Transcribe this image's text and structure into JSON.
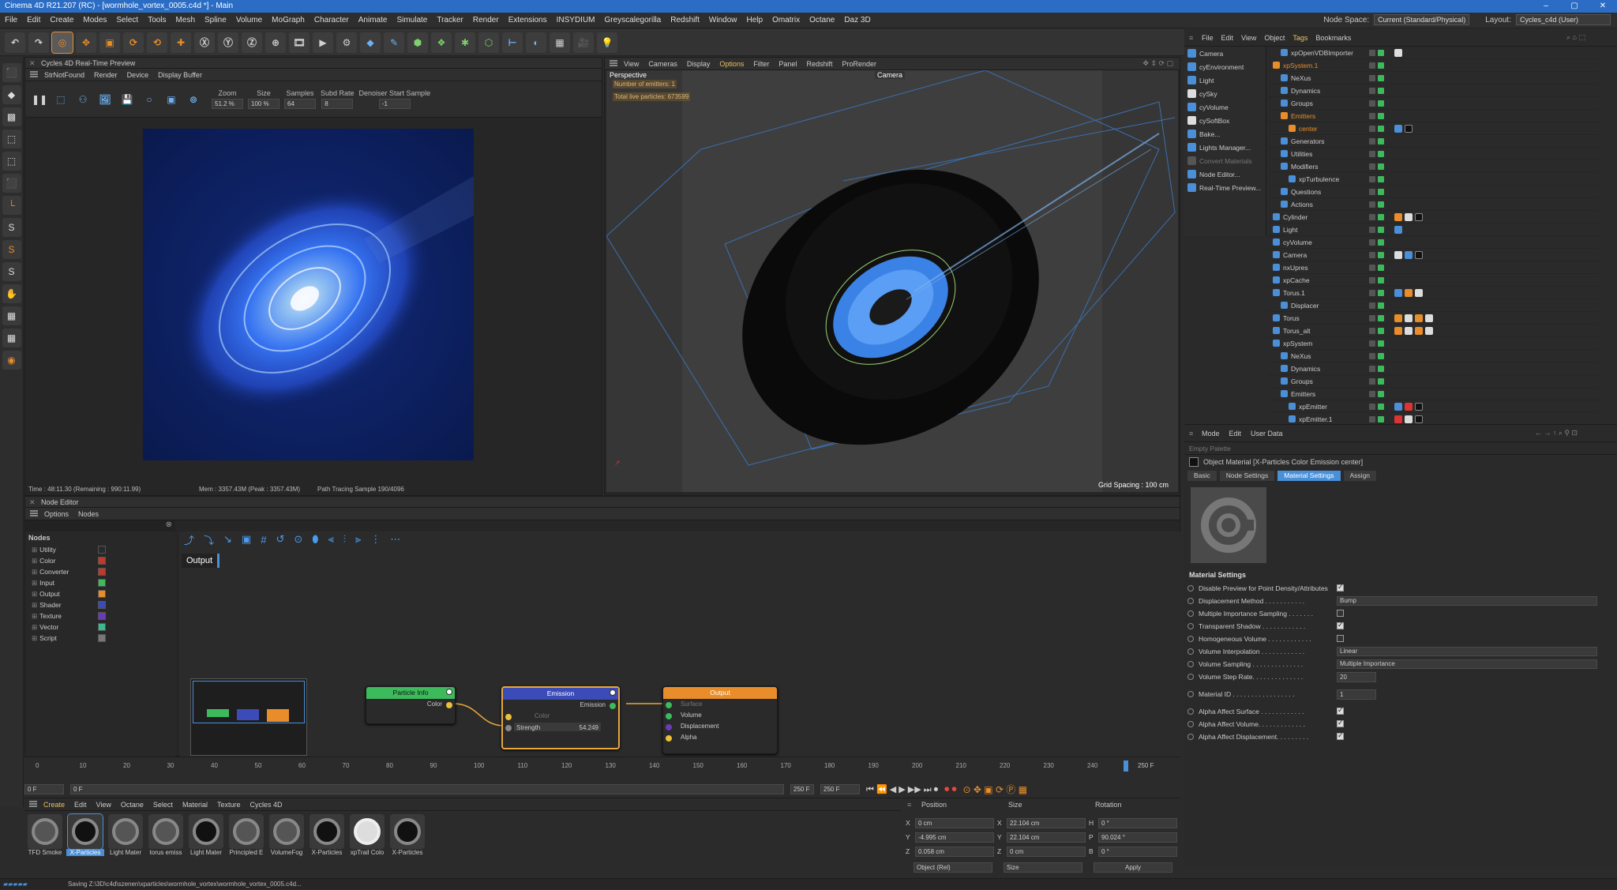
{
  "title": "Cinema 4D R21.207 (RC) - [wormhole_vortex_0005.c4d *] - Main",
  "menubar": [
    "File",
    "Edit",
    "Create",
    "Modes",
    "Select",
    "Tools",
    "Mesh",
    "Spline",
    "Volume",
    "MoGraph",
    "Character",
    "Animate",
    "Simulate",
    "Tracker",
    "Render",
    "Extensions",
    "INSYDIUM",
    "Greyscalegorilla",
    "Redshift",
    "Window",
    "Help",
    "Omatrix",
    "Octane",
    "Daz 3D"
  ],
  "node_space_label": "Node Space:",
  "node_space_value": "Current (Standard/Physical)",
  "layout_label": "Layout:",
  "layout_value": "Cycles_c4d (User)",
  "rtp": {
    "title": "Cycles 4D Real-Time Preview",
    "menu": [
      "StrNotFound",
      "Render",
      "Device",
      "Display Buffer"
    ],
    "zoom_label": "Zoom",
    "zoom": "51.2 %",
    "size_label": "Size",
    "size": "100 %",
    "samples_label": "Samples",
    "samples": "64",
    "subd_label": "Subd Rate",
    "subd": "8",
    "denoiser_label": "Denoiser Start Sample",
    "denoiser": "-1",
    "status_time": "Time : 48:11.30 (Remaining : 990:11.99)",
    "status_mem": "Mem : 3357.43M (Peak : 3357.43M)",
    "status_path": "Path Tracing Sample 190/4096"
  },
  "viewport": {
    "menu": [
      "View",
      "Cameras",
      "Display",
      "Options",
      "Filter",
      "Panel",
      "Redshift",
      "ProRender"
    ],
    "label": "Perspective",
    "camera": "Camera",
    "emitters": "Number of emitters: 1",
    "particles": "Total live particles: 673599",
    "grid": "Grid Spacing : 100 cm"
  },
  "objmgr": {
    "menu": [
      "File",
      "Edit",
      "View",
      "Object",
      "Tags",
      "Bookmarks"
    ],
    "quick": [
      "Camera",
      "cyEnvironment",
      "Light",
      "cySky",
      "cyVolume",
      "cySoftBox",
      "Bake...",
      "Lights Manager...",
      "Convert Materials",
      "Node Editor...",
      "Real-Time Preview..."
    ],
    "tree": [
      {
        "name": "xpOpenVDBImporter",
        "indent": 1,
        "orange": false
      },
      {
        "name": "xpSystem.1",
        "indent": 0,
        "orange": true
      },
      {
        "name": "NeXus",
        "indent": 1,
        "orange": false
      },
      {
        "name": "Dynamics",
        "indent": 1,
        "orange": false
      },
      {
        "name": "Groups",
        "indent": 1,
        "orange": false
      },
      {
        "name": "Emitters",
        "indent": 1,
        "orange": true
      },
      {
        "name": "center",
        "indent": 2,
        "orange": true
      },
      {
        "name": "Generators",
        "indent": 1,
        "orange": false
      },
      {
        "name": "Utilities",
        "indent": 1,
        "orange": false
      },
      {
        "name": "Modifiers",
        "indent": 1,
        "orange": false
      },
      {
        "name": "xpTurbulence",
        "indent": 2,
        "orange": false
      },
      {
        "name": "Questions",
        "indent": 1,
        "orange": false
      },
      {
        "name": "Actions",
        "indent": 1,
        "orange": false
      },
      {
        "name": "Cylinder",
        "indent": 0,
        "orange": false
      },
      {
        "name": "Light",
        "indent": 0,
        "orange": false
      },
      {
        "name": "cyVolume",
        "indent": 0,
        "orange": false
      },
      {
        "name": "Camera",
        "indent": 0,
        "orange": false
      },
      {
        "name": "nxUpres",
        "indent": 0,
        "orange": false
      },
      {
        "name": "xpCache",
        "indent": 0,
        "orange": false
      },
      {
        "name": "Torus.1",
        "indent": 0,
        "orange": false
      },
      {
        "name": "Displacer",
        "indent": 1,
        "orange": false
      },
      {
        "name": "Torus",
        "indent": 0,
        "orange": false
      },
      {
        "name": "Torus_alt",
        "indent": 0,
        "orange": false
      },
      {
        "name": "xpSystem",
        "indent": 0,
        "orange": false
      },
      {
        "name": "NeXus",
        "indent": 1,
        "orange": false
      },
      {
        "name": "Dynamics",
        "indent": 1,
        "orange": false
      },
      {
        "name": "Groups",
        "indent": 1,
        "orange": false
      },
      {
        "name": "Emitters",
        "indent": 1,
        "orange": false
      },
      {
        "name": "xpEmitter",
        "indent": 2,
        "orange": false
      },
      {
        "name": "xpEmitter.1",
        "indent": 2,
        "orange": false
      }
    ]
  },
  "attr": {
    "menu": [
      "Mode",
      "Edit",
      "User Data"
    ],
    "palette": "Empty Palette",
    "object": "Object Material [X-Particles Color Emission center]",
    "tabs": [
      "Basic",
      "Node Settings",
      "Material Settings",
      "Assign"
    ],
    "active_tab": "Material Settings",
    "section": "Material Settings",
    "props": [
      {
        "label": "Disable Preview for Point Density/Attributes",
        "type": "check",
        "value": true
      },
      {
        "label": "Displacement Method . . . . . . . . . . .",
        "type": "dropdown",
        "value": "Bump"
      },
      {
        "label": "Multiple Importance Sampling . . . . . . .",
        "type": "check",
        "value": false
      },
      {
        "label": "Transparent Shadow . . . . . . . . . . . .",
        "type": "check",
        "value": true
      },
      {
        "label": "Homogeneous Volume . . . . . . . . . . . .",
        "type": "check",
        "value": false
      },
      {
        "label": "Volume Interpolation . . . . . . . . . . . .",
        "type": "dropdown",
        "value": "Linear"
      },
      {
        "label": "Volume Sampling . . . . . . . . . . . . . .",
        "type": "dropdown",
        "value": "Multiple Importance"
      },
      {
        "label": "Volume Step Rate. . . . . . . . . . . . . .",
        "type": "number",
        "value": "20"
      },
      {
        "label": "Material ID . . . . . . . . . . . . . . . . .",
        "type": "number",
        "value": "1"
      },
      {
        "label": "Alpha Affect Surface . . . . . . . . . . . .",
        "type": "check",
        "value": true
      },
      {
        "label": "Alpha Affect Volume. . . . . . . . . . . . .",
        "type": "check",
        "value": true
      },
      {
        "label": "Alpha Affect Displacement. . . . . . . . .",
        "type": "check",
        "value": true
      }
    ]
  },
  "nodeeditor": {
    "title": "Node Editor",
    "menu": [
      "Options",
      "Nodes"
    ],
    "nodes_label": "Nodes",
    "categories": [
      {
        "name": "Utility",
        "color": "#2a2a2a"
      },
      {
        "name": "Color",
        "color": "#c0392b"
      },
      {
        "name": "Converter",
        "color": "#c0392b"
      },
      {
        "name": "Input",
        "color": "#3cba5c"
      },
      {
        "name": "Output",
        "color": "#e88d2a"
      },
      {
        "name": "Shader",
        "color": "#3b4bb8"
      },
      {
        "name": "Texture",
        "color": "#6a3bb8"
      },
      {
        "name": "Vector",
        "color": "#3cba8c"
      },
      {
        "name": "Script",
        "color": "#777777"
      }
    ],
    "tab": "Output",
    "node_particle": {
      "title": "Particle Info",
      "port": "Color"
    },
    "node_emission": {
      "title": "Emission",
      "out": "Emission",
      "color": "Color",
      "strength_label": "Strength",
      "strength": "54.249"
    },
    "node_output": {
      "title": "Output",
      "ports": [
        "Surface",
        "Volume",
        "Displacement",
        "Alpha"
      ]
    }
  },
  "timeline": {
    "ticks": [
      "0",
      "10",
      "20",
      "30",
      "40",
      "50",
      "60",
      "70",
      "80",
      "90",
      "100",
      "110",
      "120",
      "130",
      "140",
      "150",
      "160",
      "170",
      "180",
      "190",
      "200",
      "210",
      "220",
      "230",
      "240"
    ],
    "current": "250 F",
    "start": "0 F",
    "mid": "0 F",
    "end": "250 F",
    "end2": "250 F"
  },
  "matmgr": {
    "menu": [
      "Create",
      "Edit",
      "View",
      "Octane",
      "Select",
      "Material",
      "Texture",
      "Cycles 4D"
    ],
    "materials": [
      "TFD Smoke",
      "X-Particles",
      "Light Mater",
      "torus emiss",
      "Light Mater",
      "Principled E",
      "VolumeFog",
      "X-Particles",
      "xpTrail Colo",
      "X-Particles"
    ]
  },
  "coords": {
    "position_label": "Position",
    "size_label": "Size",
    "rotation_label": "Rotation",
    "x": "0 cm",
    "y": "-4.995 cm",
    "z": "0.058 cm",
    "sx": "22.104 cm",
    "sy": "22.104 cm",
    "sz": "0 cm",
    "h": "0 °",
    "p": "90.024 °",
    "b": "0 °",
    "mode": "Object (Rel)",
    "sizemode": "Size",
    "apply": "Apply"
  },
  "status": "Saving Z:\\3D\\c4d\\szenen\\xparticles\\wormhole_vortex\\wormhole_vortex_0005.c4d..."
}
